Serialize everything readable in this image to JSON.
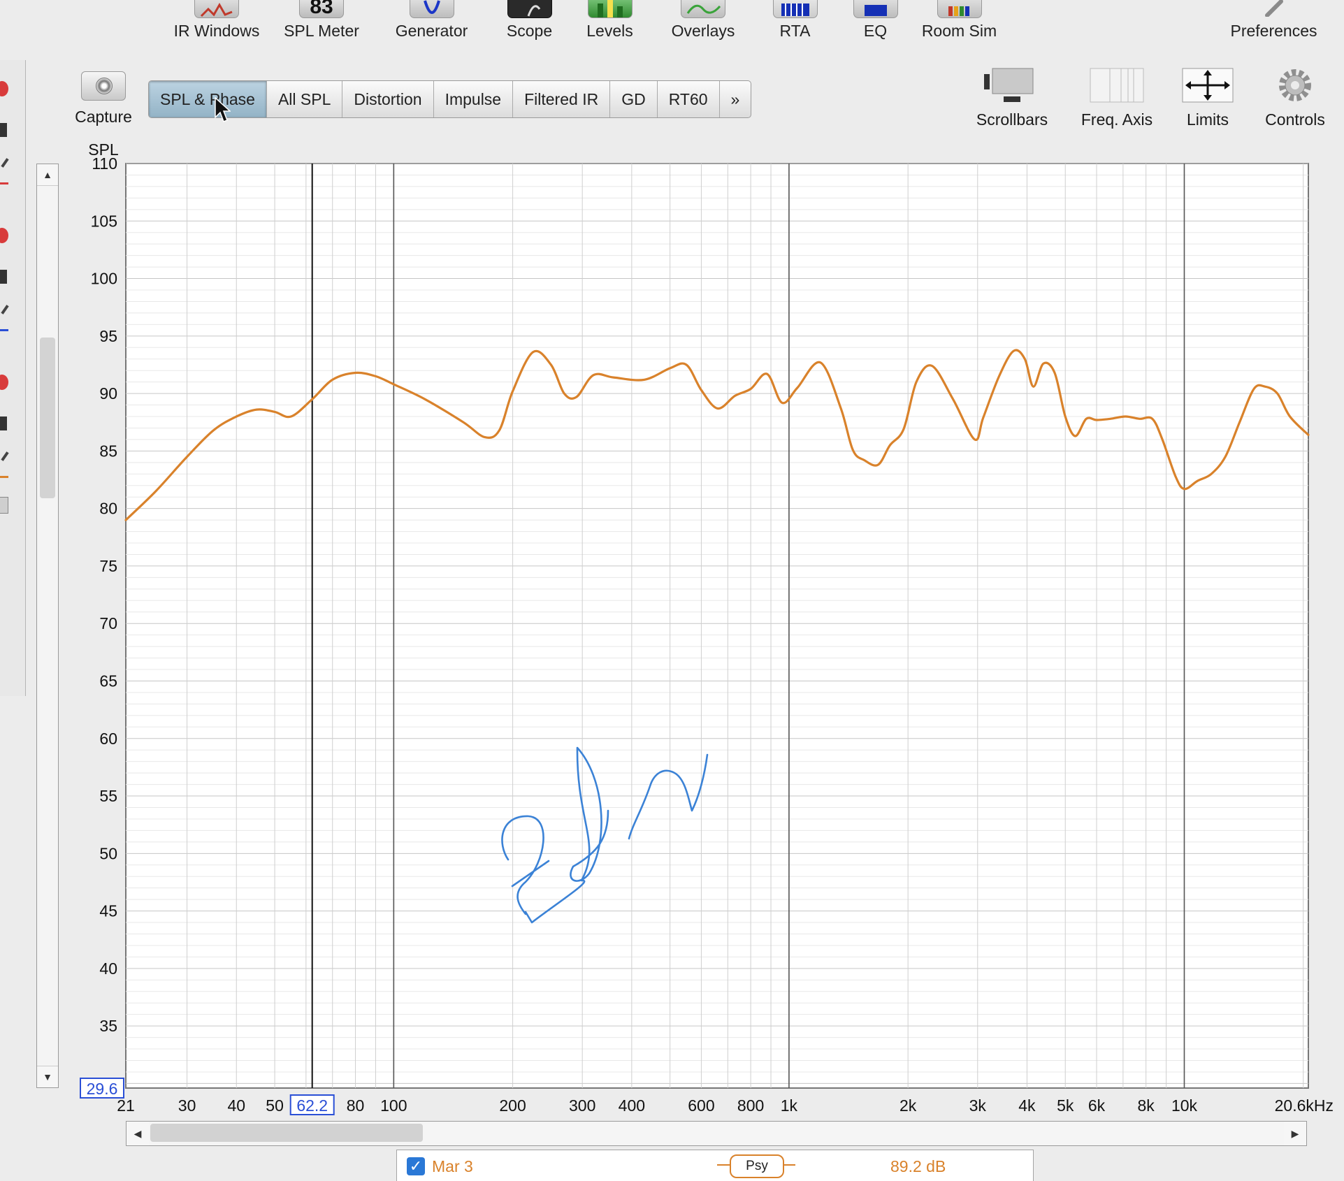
{
  "toolbar": {
    "items": [
      {
        "label": "IR Windows"
      },
      {
        "label": "SPL Meter",
        "icon_text": "83"
      },
      {
        "label": "Generator"
      },
      {
        "label": "Scope"
      },
      {
        "label": "Levels"
      },
      {
        "label": "Overlays"
      },
      {
        "label": "RTA"
      },
      {
        "label": "EQ"
      },
      {
        "label": "Room Sim"
      },
      {
        "label": "Preferences"
      }
    ]
  },
  "view": {
    "capture_label": "Capture",
    "tabs": [
      "SPL & Phase",
      "All SPL",
      "Distortion",
      "Impulse",
      "Filtered IR",
      "GD",
      "RT60",
      "»"
    ],
    "active_tab": "SPL & Phase",
    "right_tools": [
      "Scrollbars",
      "Freq. Axis",
      "Limits",
      "Controls"
    ]
  },
  "plot": {
    "y_axis_title": "SPL",
    "y_min_box": "29.6",
    "cursor_freq_box": "62.2",
    "x_unit_label": "20.6kHz"
  },
  "legend": {
    "checked": true,
    "measurement_name": "Mar 3",
    "smoothing": "Psy",
    "value": "89.2 dB"
  },
  "colors": {
    "trace": "#d9822b",
    "accent": "#2a78d6",
    "annotation_ink": "#3b82d6",
    "active_tab": "#a7c2d4"
  },
  "chart_data": {
    "type": "line",
    "xscale": "log",
    "xlim": [
      21,
      20600
    ],
    "ylim": [
      29.6,
      110
    ],
    "ylabel": "SPL",
    "y_ticks": [
      110,
      105,
      100,
      95,
      90,
      85,
      80,
      75,
      70,
      65,
      60,
      55,
      50,
      45,
      40,
      35
    ],
    "x_ticks": [
      {
        "v": 21,
        "label": "21"
      },
      {
        "v": 30,
        "label": "30"
      },
      {
        "v": 40,
        "label": "40"
      },
      {
        "v": 50,
        "label": "50"
      },
      {
        "v": 80,
        "label": "80"
      },
      {
        "v": 100,
        "label": "100"
      },
      {
        "v": 200,
        "label": "200"
      },
      {
        "v": 300,
        "label": "300"
      },
      {
        "v": 400,
        "label": "400"
      },
      {
        "v": 600,
        "label": "600"
      },
      {
        "v": 800,
        "label": "800"
      },
      {
        "v": 1000,
        "label": "1k"
      },
      {
        "v": 2000,
        "label": "2k"
      },
      {
        "v": 3000,
        "label": "3k"
      },
      {
        "v": 4000,
        "label": "4k"
      },
      {
        "v": 5000,
        "label": "5k"
      },
      {
        "v": 6000,
        "label": "6k"
      },
      {
        "v": 8000,
        "label": "8k"
      },
      {
        "v": 10000,
        "label": "10k"
      }
    ],
    "cursor_x": 62.2,
    "series": [
      {
        "name": "Mar 3",
        "x": [
          21,
          25,
          30,
          35,
          40,
          45,
          50,
          55,
          62.2,
          70,
          80,
          90,
          100,
          120,
          150,
          170,
          185,
          200,
          225,
          250,
          270,
          290,
          320,
          360,
          430,
          500,
          550,
          600,
          660,
          730,
          800,
          880,
          960,
          1050,
          1200,
          1350,
          1450,
          1550,
          1680,
          1800,
          1950,
          2100,
          2300,
          2600,
          2950,
          3100,
          3400,
          3700,
          3950,
          4150,
          4400,
          4700,
          5000,
          5300,
          5650,
          6000,
          6500,
          7100,
          7700,
          8300,
          8800,
          9500,
          10000,
          10800,
          11700,
          12700,
          13800,
          15000,
          16000,
          17200,
          18500,
          20600
        ],
        "y": [
          79,
          81.5,
          84.5,
          86.8,
          88,
          88.6,
          88.4,
          88,
          89.5,
          91.2,
          91.8,
          91.5,
          90.8,
          89.5,
          87.5,
          86.2,
          86.8,
          90.2,
          93.6,
          92.5,
          90,
          89.7,
          91.6,
          91.4,
          91.2,
          92.2,
          92.5,
          90.3,
          88.7,
          89.8,
          90.4,
          91.7,
          89.2,
          90.5,
          92.7,
          88.8,
          85.1,
          84.2,
          83.8,
          85.5,
          86.9,
          91,
          92.4,
          89.5,
          86,
          87.9,
          91.5,
          93.7,
          93,
          90.6,
          92.6,
          91.8,
          88,
          86.3,
          87.8,
          87.7,
          87.8,
          88,
          87.8,
          87.8,
          86,
          82.8,
          81.7,
          82.4,
          83,
          84.5,
          87.5,
          90.4,
          90.6,
          90,
          88,
          86.4
        ]
      }
    ]
  }
}
